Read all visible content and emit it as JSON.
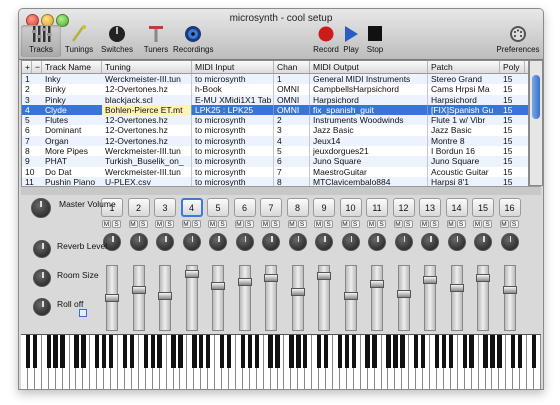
{
  "window": {
    "title": "microsynth - cool setup"
  },
  "toolbar": {
    "left": [
      {
        "label": "Tracks",
        "icon": "tracks-icon",
        "active": true
      },
      {
        "label": "Tunings",
        "icon": "tunings-icon"
      },
      {
        "label": "Switches",
        "icon": "switches-icon"
      },
      {
        "label": "Tuners",
        "icon": "tuners-icon"
      },
      {
        "label": "Recordings",
        "icon": "recordings-icon"
      }
    ],
    "record_label": "Record",
    "play_label": "Play",
    "stop_label": "Stop",
    "preferences_label": "Preferences"
  },
  "table": {
    "columns": [
      "+",
      "−",
      "Track Name",
      "Tuning",
      "MIDI Input",
      "Chan",
      "MIDI Output",
      "Patch",
      "Poly"
    ],
    "rows": [
      [
        "1",
        "Inky",
        "Werckmeister-III.tun",
        "to microsynth",
        "1",
        "General MIDI Instruments",
        "Stereo Grand",
        "15"
      ],
      [
        "2",
        "Binky",
        "12-Overtones.hz",
        "h-Book",
        "OMNI",
        "CampbellsHarpsichord",
        "Cams Hrpsi Ma",
        "15"
      ],
      [
        "3",
        "Pinky",
        "blackjack.scl",
        "E-MU XMidi1X1 Tab",
        "OMNI",
        "Harpsichord",
        "Harpsichord",
        "15"
      ],
      [
        "4",
        "Clyde",
        "Bohlen-Pierce ET.mt",
        "LPK25 : LPK25",
        "OMNI",
        "fix_spanish_guit",
        "[FIX]Spanish Gu",
        "15"
      ],
      [
        "5",
        "Flutes",
        "12-Overtones.hz",
        "to microsynth",
        "2",
        "Instruments Woodwinds",
        "Flute 1 w/ Vibr",
        "15"
      ],
      [
        "6",
        "Dominant",
        "12-Overtones.hz",
        "to microsynth",
        "3",
        "Jazz Basic",
        "Jazz Basic",
        "15"
      ],
      [
        "7",
        "Organ",
        "12-Overtones.hz",
        "to microsynth",
        "4",
        "Jeux14",
        "Montre 8",
        "15"
      ],
      [
        "8",
        "More Pipes",
        "Werckmeister-III.tun",
        "to microsynth",
        "5",
        "jeuxdorgues21",
        "I Bordun 16",
        "15"
      ],
      [
        "9",
        "PHAT",
        "Turkish_Buselik_on_",
        "to microsynth",
        "6",
        "Juno Square",
        "Juno Square",
        "15"
      ],
      [
        "10",
        "Do Dat",
        "Werckmeister-III.tun",
        "to microsynth",
        "7",
        "MaestroGuitar",
        "Acoustic Guitar",
        "15"
      ],
      [
        "11",
        "Pushin Piano",
        "U-PLEX.csv",
        "to microsynth",
        "8",
        "MTClavicembalo884",
        "Harpsi 8'1",
        "15"
      ]
    ],
    "selected_row": 3
  },
  "mixer": {
    "channels": [
      "1",
      "2",
      "3",
      "4",
      "5",
      "6",
      "7",
      "8",
      "9",
      "10",
      "11",
      "12",
      "13",
      "14",
      "15",
      "16"
    ],
    "selected_channel": 3,
    "mute_label": "M",
    "solo_label": "S",
    "master_volume_label": "Master Volume",
    "reverb_level_label": "Reverb Level",
    "room_size_label": "Room Size",
    "roll_off_label": "Roll off"
  }
}
